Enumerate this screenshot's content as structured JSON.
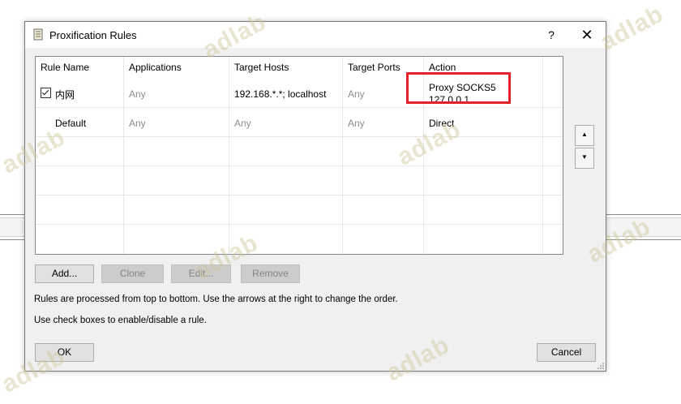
{
  "dialog": {
    "title": "Proxification Rules",
    "help_label": "?",
    "close_label": "✕"
  },
  "table": {
    "columns": [
      "Rule Name",
      "Applications",
      "Target Hosts",
      "Target Ports",
      "Action"
    ],
    "rows": [
      {
        "checked": true,
        "name": "内网",
        "applications": "Any",
        "target_hosts": "192.168.*.*; localhost",
        "target_ports": "Any",
        "action_line1": "Proxy SOCKS5",
        "action_line2": "127.0.0.1"
      },
      {
        "checked": false,
        "name": "Default",
        "applications": "Any",
        "target_hosts": "Any",
        "target_ports": "Any",
        "action_line1": "Direct",
        "action_line2": ""
      }
    ]
  },
  "order_buttons": {
    "up": "▲",
    "down": "▼"
  },
  "buttons": {
    "add": "Add...",
    "clone": "Clone",
    "edit": "Edit...",
    "remove": "Remove",
    "ok": "OK",
    "cancel": "Cancel"
  },
  "notes": {
    "line1": "Rules are processed from top to bottom. Use the arrows at the right to change the order.",
    "line2": "Use check boxes to enable/disable a rule."
  },
  "watermark_text": "adlab",
  "colors": {
    "highlight": "#e5202a",
    "dialog_bg": "#f0f0f0",
    "dim_text": "#8c8c8c"
  }
}
